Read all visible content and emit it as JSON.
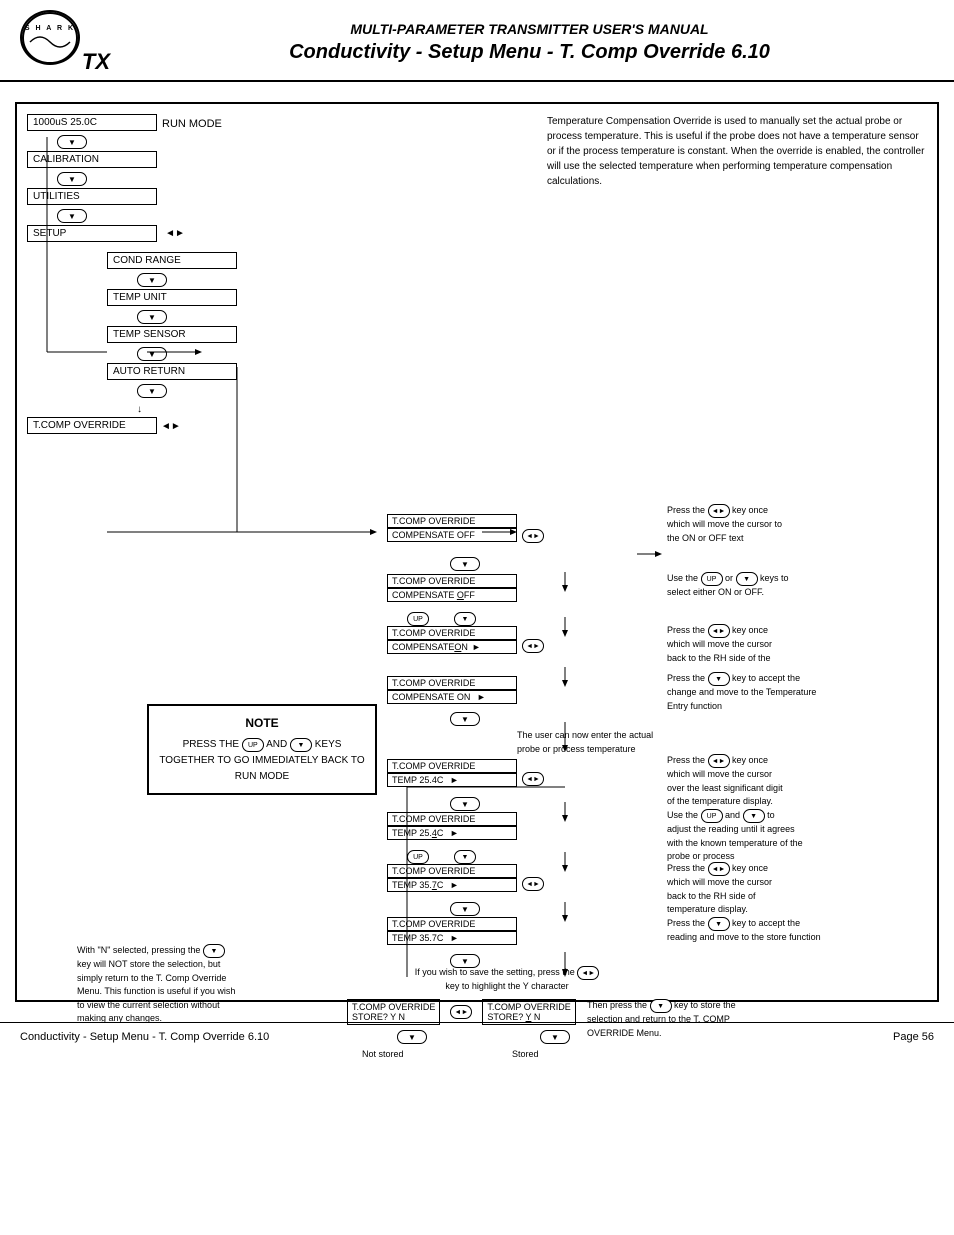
{
  "header": {
    "title1": "MULTI-PARAMETER TRANSMITTER USER'S MANUAL",
    "title2": "Conductivity - Setup Menu - T. Comp Override 6.10",
    "logo_text": "SHARK"
  },
  "description": {
    "text": "Temperature Compensation Override is used to manually set the actual probe or process temperature. This is useful if the probe does not have a temperature sensor or if the process temperature is constant. When the override is enabled, the controller will use the selected temperature when performing temperature compensation calculations."
  },
  "menu_items": {
    "reading": "1000uS  25.0C",
    "run_mode": "RUN MODE",
    "calibration": "CALIBRATION",
    "utilities": "UTILITIES",
    "setup": "SETUP",
    "cond_range": "COND RANGE",
    "temp_unit": "TEMP UNIT",
    "temp_sensor": "TEMP SENSOR",
    "auto_return": "AUTO RETURN",
    "tcomp_override": "T.COMP OVERRIDE"
  },
  "flow_items": {
    "tcomp_override_label": "T.COMP OVERRIDE",
    "compensate_off": "COMPENSATE OFF",
    "compensate_off2": "COMPENSATE OFF",
    "compensate_d_ff": "COMPENSATE  OFF",
    "compensate_on": "COMPENSATE ON",
    "compensate_on2": "COMPENSATE  ON",
    "compensate_on3": "COMPENSATE  ON",
    "temp_25_4c": "TEMP   25.4C",
    "temp_25_4c2": "TEMP   25.4C",
    "temp_35_7c": "TEMP   35.7C",
    "temp_35_7c2": "TEMP   35.7C",
    "store_yn": "STORE?       Y  N",
    "store_yn2": "STORE?       Y  N"
  },
  "notes": {
    "title": "NOTE",
    "line1": "PRESS THE",
    "and": "AND",
    "keys": "KEYS",
    "line2": "TOGETHER TO GO IMMEDIATELY BACK TO",
    "line3": "RUN MODE"
  },
  "descriptions": {
    "press_enter_once": "Press the       key once\nwhich will move the cursor to\nthe ON or OFF text",
    "use_up_down": "Use the       or       keys to\nselect either ON or OFF.",
    "press_enter_back": "Press the       key once\nwhich will move the cursor\nback to the RH side of the",
    "press_down_accept": "Press the       key to accept the\nchange and move to the Temperature\nEntry function",
    "user_can_enter": "The user can now enter the actual\nprobe or process temperature",
    "press_enter_lsd": "Press the       key once\nwhich will move the cursor\nover the least significant digit\nof the temperature display.",
    "use_up_down_adjust": "Use the       and       to\nadjust the reading until it agrees\nwith the known temperature of the\nprobe or process",
    "press_enter_rh": "Press the       key once\nwhich will move the cursor\nback to the RH side of\ntemperature display.",
    "press_down_store": "Press the       key to accept the\nreading and move to the store function",
    "save_setting": "If you wish to save the setting, press the\nkey to highlight the Y character",
    "not_stored_note": "With \"N\" selected, pressing the\nkey will NOT store the selection, but\nsimply return to the T. Comp Override\nMenu. This function is useful if you wish\nto view the current selection without\nmaking any changes.",
    "not_stored": "Not stored",
    "stored": "Stored",
    "then_press": "Then press the       key to store the\nselection and return to the T. COMP\nOVERRIDE Menu."
  },
  "footer": {
    "left": "Conductivity - Setup Menu - T. Comp Override 6.10",
    "right": "Page 56"
  }
}
